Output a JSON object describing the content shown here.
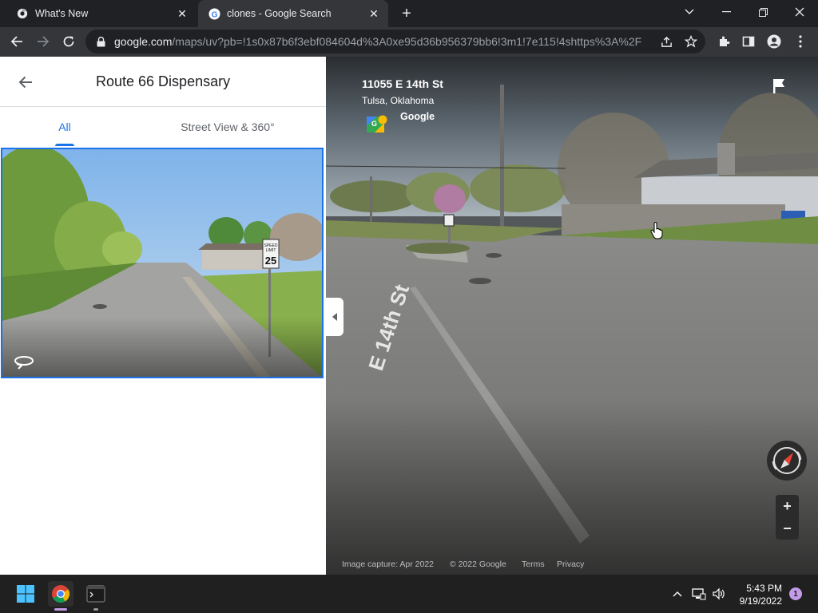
{
  "browser": {
    "tabs": [
      {
        "title": "What's New",
        "icon": "chrome-icon",
        "active": false
      },
      {
        "title": "clones - Google Search",
        "icon": "google-icon",
        "active": true
      }
    ],
    "url_domain": "google.com",
    "url_rest": "/maps/uv?pb=!1s0x87b6f3ebf084604d%3A0xe95d36b956379bb6!3m1!7e115!4shttps%3A%2F..."
  },
  "panel": {
    "title": "Route 66 Dispensary",
    "tabs": [
      {
        "label": "All",
        "selected": true
      },
      {
        "label": "Street View & 360°",
        "selected": false
      }
    ],
    "thumbnail_sign": {
      "line1": "SPEED",
      "line2": "LIMIT",
      "value": "25"
    }
  },
  "streetview": {
    "address": "11055 E 14th St",
    "city": "Tulsa, Oklahoma",
    "brand": "Google",
    "image_capture": "Image capture: Apr 2022",
    "copyright": "© 2022 Google",
    "terms": "Terms",
    "privacy": "Privacy",
    "road_text": "E 14th St",
    "zoom_in": "+",
    "zoom_out": "−"
  },
  "taskbar": {
    "time": "5:43 PM",
    "date": "9/19/2022",
    "notifications": "1"
  },
  "colors": {
    "accent": "#1a73e8",
    "chrome_dark": "#202124",
    "chrome_toolbar": "#35363a"
  }
}
